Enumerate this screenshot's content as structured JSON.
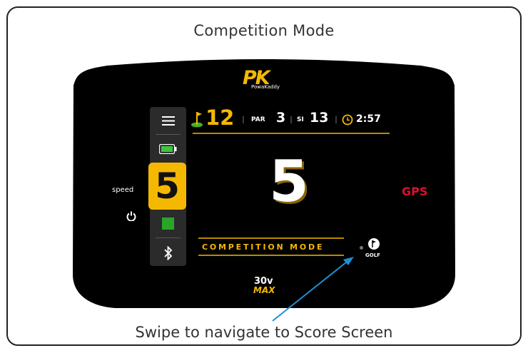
{
  "page": {
    "title": "Competition Mode",
    "caption": "Swipe to navigate to Score Screen"
  },
  "logo": {
    "brand": "PK",
    "name": "PowaKaddy"
  },
  "status": {
    "hole": "12",
    "par_label": "PAR",
    "par": "3",
    "si_label": "SI",
    "si": "13",
    "time": "2:57"
  },
  "side": {
    "speed_label": "speed",
    "speed_value": "5",
    "gps": "GPS"
  },
  "main": {
    "speed": "5",
    "mode": "COMPETITION MODE",
    "golf": "GOLF"
  },
  "model": {
    "line1": "30v",
    "line2": "MAX"
  },
  "colors": {
    "accent": "#f5b800",
    "gps": "#d8102e",
    "arrow": "#1f8fd6",
    "battery": "#3ec43e",
    "stop": "#2aa52a",
    "screen": "#000000"
  },
  "icons": [
    "menu-icon",
    "battery-icon",
    "power-icon",
    "stop-icon",
    "bluetooth-icon",
    "clock-icon",
    "flag-icon",
    "golf-icon"
  ]
}
